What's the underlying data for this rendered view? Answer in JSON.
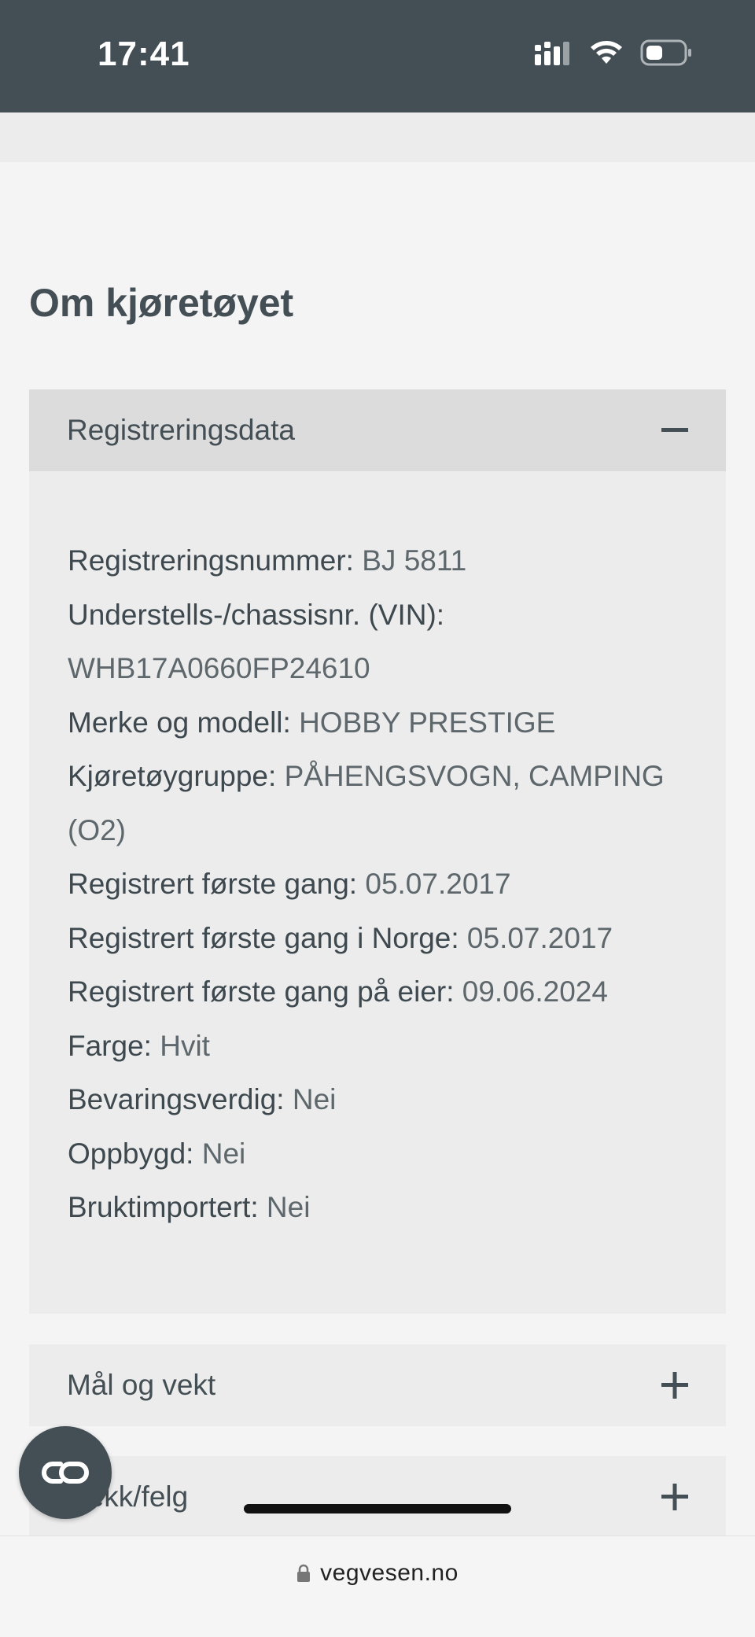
{
  "status_bar": {
    "time": "17:41"
  },
  "page": {
    "title": "Om kjøretøyet"
  },
  "registration": {
    "title": "Registreringsdata",
    "toggle": "−",
    "rows": [
      {
        "label": "Registreringsnummer:",
        "value": "BJ 5811"
      },
      {
        "label": "Understells-/chassisnr. (VIN):",
        "value": "WHB17A0660FP24610"
      },
      {
        "label": "Merke og modell:",
        "value": "HOBBY PRESTIGE"
      },
      {
        "label": "Kjøretøygruppe:",
        "value": "PÅHENGSVOGN, CAMPING (O2)"
      },
      {
        "label": "Registrert første gang:",
        "value": "05.07.2017"
      },
      {
        "label": "Registrert første gang i Norge:",
        "value": "05.07.2017"
      },
      {
        "label": "Registrert første gang på eier:",
        "value": "09.06.2024"
      },
      {
        "label": "Farge:",
        "value": "Hvit"
      },
      {
        "label": "Bevaringsverdig:",
        "value": "Nei"
      },
      {
        "label": "Oppbygd:",
        "value": "Nei"
      },
      {
        "label": "Bruktimportert:",
        "value": "Nei"
      }
    ]
  },
  "sections": [
    {
      "title": "Mål og vekt",
      "toggle": "+"
    },
    {
      "title": "Dekk/felg",
      "toggle": "+"
    }
  ],
  "browser": {
    "url": "vegvesen.no"
  },
  "icons": {
    "signal": "signal-icon",
    "wifi": "wifi-icon",
    "battery": "battery-icon",
    "lock": "lock-icon",
    "fab": "link-icon"
  },
  "colors": {
    "header_bg": "#444f55",
    "accordion_open_header": "#dcdcdc",
    "accordion_bg": "#ececec"
  }
}
